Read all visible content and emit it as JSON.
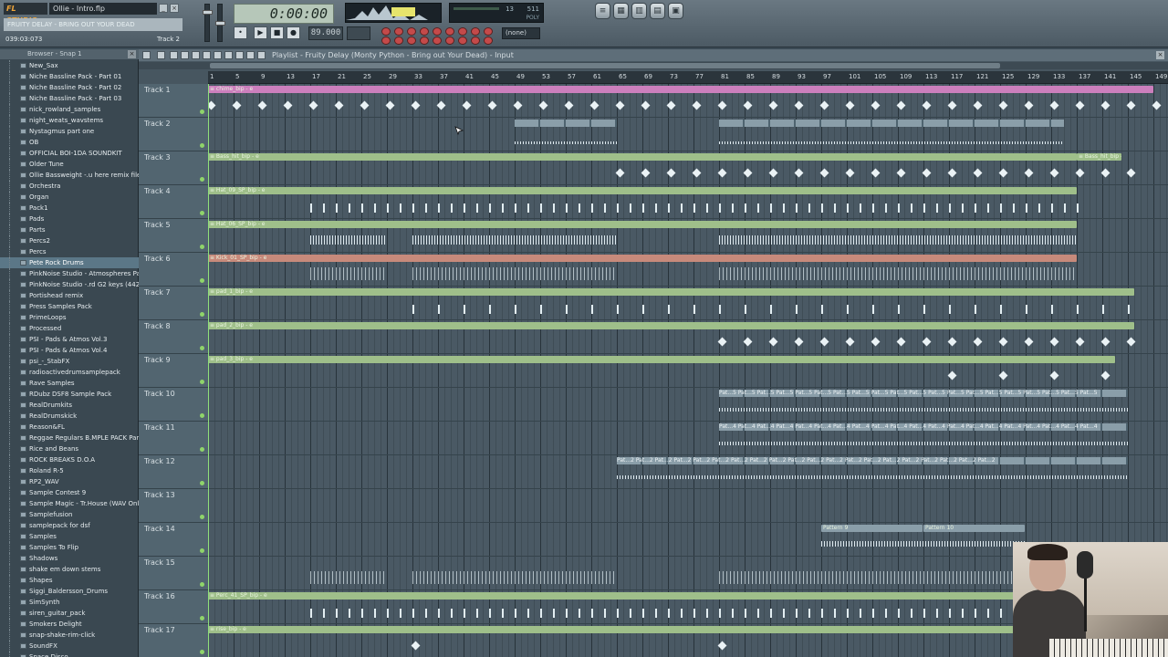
{
  "app": {
    "logo": "FL STUDIO",
    "project_title": "Ollie - Intro.flp",
    "hint_bar": "FRUITY DELAY - BRING OUT YOUR DEAD",
    "time_readout": "039:03:073",
    "hint_target": "Track 2"
  },
  "transport": {
    "song_time": "0:00:00",
    "tempo": "89.000",
    "pattern": "",
    "pattern_select": "(none)",
    "cpu": "13",
    "ram": "511",
    "poly_label": "POLY"
  },
  "browser": {
    "header": "Browser - Snap 1",
    "items": [
      "New_Sax",
      "Niche Bassline Pack - Part 01",
      "Niche Bassline Pack - Part 02",
      "Niche Bassline Pack - Part 03",
      "nick_rowland_samples",
      "night_weats_wavstems",
      "Nystagmus part one",
      "OB",
      "OFFICIAL BOI-1DA SOUNDKIT",
      "Older Tune",
      "Ollie Bassweight -.u here remix files",
      "Orchestra",
      "Organ",
      "Pack1",
      "Pads",
      "Parts",
      "Percs2",
      "Percs",
      "Pete Rock Drums",
      "PinkNoise Studio - Atmospheres Pack",
      "PinkNoise Studio -.rd G2 keys (4424)",
      "Portishead remix",
      "Press Samples Pack",
      "PrimeLoops",
      "Processed",
      "PSI - Pads & Atmos Vol.3",
      "PSI - Pads & Atmos Vol.4",
      "psi_-_StabFX",
      "radioactivedrumsamplepack",
      "Rave Samples",
      "RDubz DSF8 Sample Pack",
      "RealDrumkits",
      "RealDrumskick",
      "Reason&FL",
      "Reggae Regulars B.MPLE PACK Part A",
      "Rice and Beans",
      "ROCK BREAKS D.O.A",
      "Roland R-5",
      "RP2_WAV",
      "Sample Contest 9",
      "Sample Magic - Tr.House (WAV Only)",
      "Samplefusion",
      "samplepack for dsf",
      "Samples",
      "Samples To Flip",
      "Shadows",
      "shake em down stems",
      "Shapes",
      "Siggi_Baldersson_Drums",
      "SimSynth",
      "siren_guitar_pack",
      "Smokers Delight",
      "snap-shake-rim-click",
      "SoundFX",
      "Space Disco"
    ],
    "selected_index": 18
  },
  "playlist": {
    "title": "Playlist - Fruity Delay (Monty Python - Bring out Your Dead) - Input",
    "bar_numbers": [
      "1",
      "5",
      "9",
      "13",
      "17",
      "21",
      "25",
      "29",
      "33",
      "37",
      "41",
      "45",
      "49",
      "53",
      "57",
      "61",
      "65",
      "69",
      "73",
      "77",
      "81",
      "85",
      "89",
      "93",
      "97",
      "101",
      "105",
      "109",
      "113",
      "117",
      "121",
      "125",
      "129",
      "133",
      "137",
      "141",
      "145",
      "149"
    ],
    "tracks": [
      {
        "label": "Track 1",
        "clip": "chime_bip",
        "clip_start_bar": 1,
        "clip_end_bar": 149,
        "color": "pink",
        "content": "notes",
        "c_from": 1,
        "c_to": 149,
        "c_step": 4
      },
      {
        "label": "Track 2",
        "clip": "",
        "clip_start_bar": 0,
        "clip_end_bar": 0,
        "color": "",
        "content": "patterns2",
        "c_from": 49,
        "c_to": 135,
        "c_step": 0
      },
      {
        "label": "Track 3",
        "clip": "Bass_hit_bip",
        "clip_start_bar": 1,
        "clip_end_bar": 137,
        "color": "green",
        "clip2": "Bass_hit_bip",
        "clip2_start_bar": 137,
        "clip2_end_bar": 144,
        "content": "notes",
        "c_from": 65,
        "c_to": 145,
        "c_step": 4
      },
      {
        "label": "Track 4",
        "clip": "Hat_09_SP_bip",
        "clip_start_bar": 1,
        "clip_end_bar": 137,
        "color": "green",
        "content": "ticks",
        "c_from": 17,
        "c_to": 137,
        "c_step": 2
      },
      {
        "label": "Track 5",
        "clip": "Hat_06_SP_bip",
        "clip_start_bar": 1,
        "clip_end_bar": 137,
        "color": "green",
        "content": "dense",
        "c_from": 17,
        "c_to": 137,
        "c_step": 0
      },
      {
        "label": "Track 6",
        "clip": "Kick_01_SP_bip",
        "clip_start_bar": 1,
        "clip_end_bar": 137,
        "color": "red",
        "content": "wavey",
        "c_from": 17,
        "c_to": 137,
        "c_step": 0
      },
      {
        "label": "Track 7",
        "clip": "pad_1_bip",
        "clip_start_bar": 1,
        "clip_end_bar": 146,
        "color": "green",
        "content": "ticks",
        "c_from": 33,
        "c_to": 145,
        "c_step": 4
      },
      {
        "label": "Track 8",
        "clip": "pad_2_bip",
        "clip_start_bar": 1,
        "clip_end_bar": 146,
        "color": "green",
        "content": "diamonds",
        "c_from": 81,
        "c_to": 145,
        "c_step": 4
      },
      {
        "label": "Track 9",
        "clip": "pad_3_bip",
        "clip_start_bar": 1,
        "clip_end_bar": 143,
        "color": "green",
        "content": "diamonds",
        "c_from": 117,
        "c_to": 141,
        "c_step": 8
      },
      {
        "label": "Track 10",
        "clip": "",
        "clip_start_bar": 0,
        "clip_end_bar": 0,
        "color": "",
        "content": "pattern-row",
        "pattern_label": "Pat...5",
        "c_from": 81,
        "c_to": 145,
        "c_step": 0
      },
      {
        "label": "Track 11",
        "clip": "",
        "clip_start_bar": 0,
        "clip_end_bar": 0,
        "color": "",
        "content": "pattern-row",
        "pattern_label": "Pat...4",
        "c_from": 81,
        "c_to": 145,
        "c_step": 0
      },
      {
        "label": "Track 12",
        "clip": "",
        "clip_start_bar": 0,
        "clip_end_bar": 0,
        "color": "",
        "content": "pattern-row",
        "pattern_label": "Pat...2",
        "c_from": 65,
        "c_to": 145,
        "c_step": 0
      },
      {
        "label": "Track 13",
        "clip": "",
        "clip_start_bar": 0,
        "clip_end_bar": 0,
        "color": "",
        "content": "none",
        "c_from": 0,
        "c_to": 0,
        "c_step": 0
      },
      {
        "label": "Track 14",
        "clip": "",
        "clip_start_bar": 0,
        "clip_end_bar": 0,
        "color": "",
        "content": "pattern9",
        "pattern_a": "Pattern 9",
        "pattern_b": "Pattern 10",
        "c_from": 97,
        "c_to": 129,
        "c_step": 0
      },
      {
        "label": "Track 15",
        "clip": "",
        "clip_start_bar": 0,
        "clip_end_bar": 0,
        "color": "",
        "content": "wavey",
        "c_from": 17,
        "c_to": 129,
        "c_step": 0
      },
      {
        "label": "Track 16",
        "clip": "Perc_41_SP_bip",
        "clip_start_bar": 1,
        "clip_end_bar": 128,
        "color": "green",
        "content": "ticks",
        "c_from": 17,
        "c_to": 127,
        "c_step": 2
      },
      {
        "label": "Track 17",
        "clip": "rise_bip",
        "clip_start_bar": 1,
        "clip_end_bar": 128,
        "color": "green",
        "content": "diamonds",
        "c_from": 33,
        "c_to": 81,
        "c_step": 48
      }
    ]
  },
  "colors": {
    "pink": "#cc7fbd",
    "green": "#9fbf8a",
    "red": "#c78a7b"
  }
}
